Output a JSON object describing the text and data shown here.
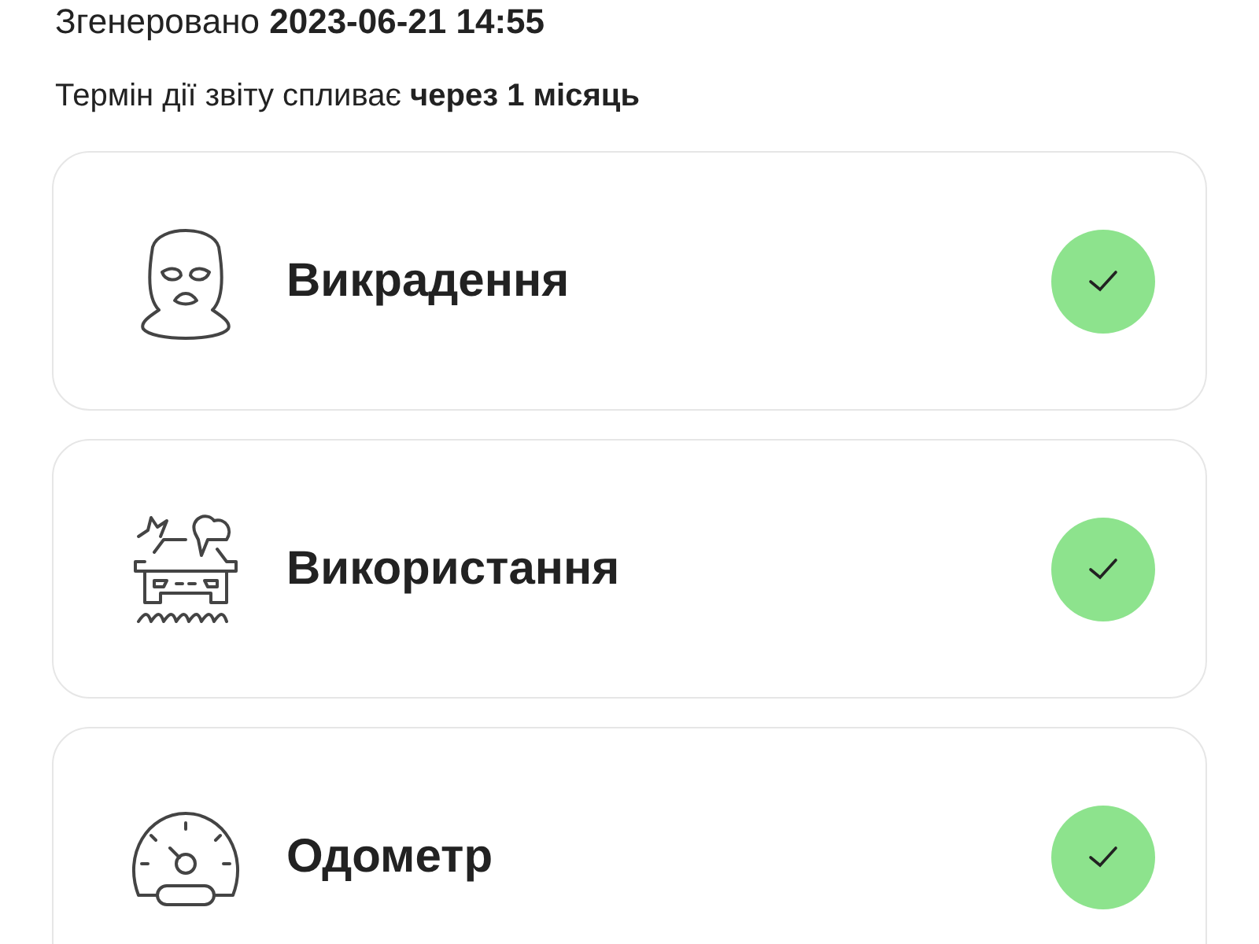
{
  "generated": {
    "label": "Згенеровано",
    "value": "2023-06-21 14:55"
  },
  "expiry": "Термін дії звіту спливає **через 1 місяць**",
  "checks": [
    {
      "kind": "mask",
      "title": "Викрадення",
      "checked": true
    },
    {
      "kind": "car",
      "title": "Використання",
      "checked": true
    },
    {
      "kind": "gauge",
      "title": "Одометр",
      "checked": true
    }
  ]
}
